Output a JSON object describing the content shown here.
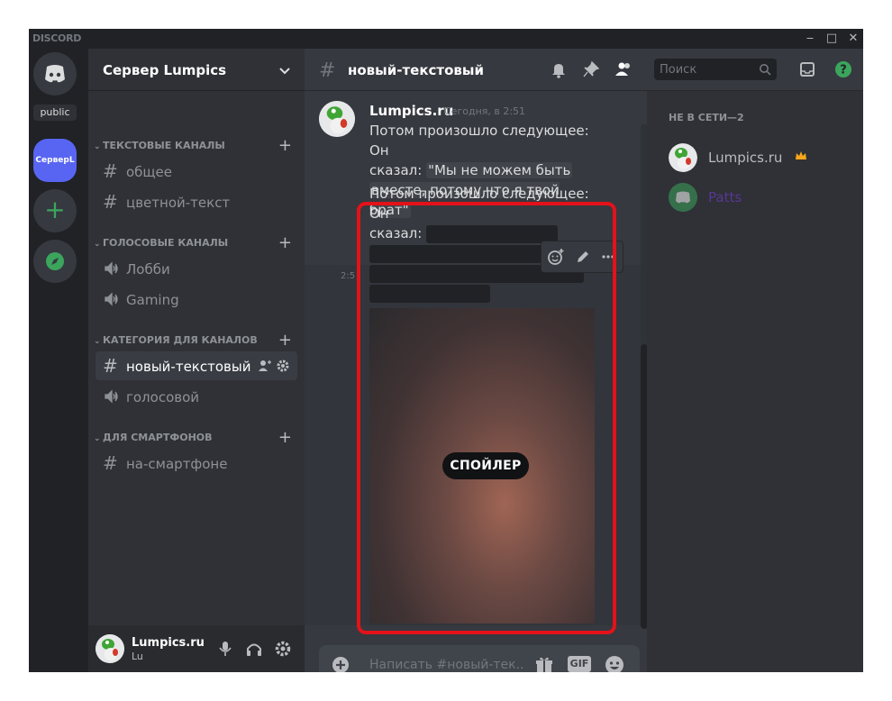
{
  "app": {
    "wordmark": "DISCORD"
  },
  "window_controls": {
    "minimize": "‒",
    "maximize": "□",
    "close": "✕"
  },
  "guilds": {
    "public_label": "public",
    "server_label": "СерверL"
  },
  "sidebar": {
    "server_name": "Сервер Lumpics",
    "categories": [
      {
        "name": "ТЕКСТОВЫЕ КАНАЛЫ",
        "channels": [
          "общее",
          "цветной-текст"
        ]
      },
      {
        "name": "ГОЛОСОВЫЕ КАНАЛЫ",
        "channels": [
          "Лобби",
          "Gaming"
        ]
      },
      {
        "name": "КАТЕГОРИЯ ДЛЯ КАНАЛОВ",
        "channels": [
          "новый-текстовый",
          "голосовой"
        ]
      },
      {
        "name": "ДЛЯ СМАРТФОНОВ",
        "channels": [
          "на-смартфоне"
        ]
      }
    ],
    "active_channel": "новый-текстовый"
  },
  "user_panel": {
    "name": "Lumpics.ru",
    "tag": "Lu"
  },
  "chat": {
    "channel_name": "новый-текстовый",
    "search_placeholder": "Поиск",
    "message": {
      "author": "Lumpics.ru",
      "timestamp": "Сегодня, в 2:51",
      "line1": "Потом произошло следующее: Он",
      "line2_prefix": "сказал: ",
      "spoiler_revealed_1": "\"Мы не можем быть",
      "spoiler_revealed_2": "вместе, потому что я твой брат\"",
      "line3": "Потом произошло следующее: Он",
      "line4_prefix": "сказал: ",
      "side_time": "2:5",
      "spoiler_tag": "СПОЙЛЕР"
    },
    "composer_placeholder": "Написать #новый-тек...",
    "gif_label": "GIF"
  },
  "members": {
    "heading": "НЕ В СЕТИ—2",
    "list": [
      {
        "name": "Lumpics.ru",
        "owner": true,
        "color": "#b9bbbe"
      },
      {
        "name": "Patts",
        "owner": false,
        "color": "#593695"
      }
    ]
  },
  "colors": {
    "accent": "#5865f2",
    "green": "#3ba55d",
    "highlight_border": "#e3121a",
    "crown": "#faa61a"
  }
}
